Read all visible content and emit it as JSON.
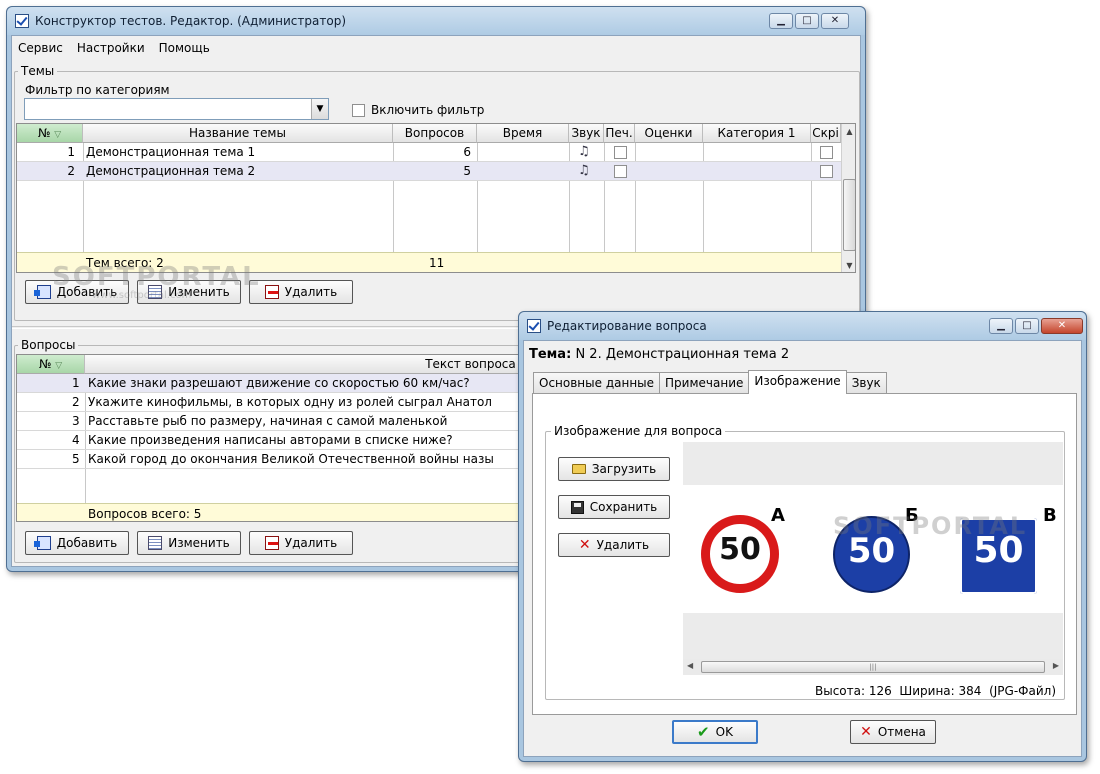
{
  "main_window": {
    "title": "Конструктор тестов. Редактор.  (Администратор)",
    "menu": [
      "Сервис",
      "Настройки",
      "Помощь"
    ],
    "topics": {
      "group_label": "Темы",
      "filter_label": "Фильтр по категориям",
      "filter_value": "",
      "enable_filter_label": "Включить фильтр",
      "columns": [
        "№",
        "Название темы",
        "Вопросов",
        "Время",
        "Звук",
        "Печ.",
        "Оценки",
        "Категория 1",
        "Скрі"
      ],
      "rows": [
        {
          "num": "1",
          "name": "Демонстрационная тема 1",
          "questions": "6"
        },
        {
          "num": "2",
          "name": "Демонстрационная тема 2",
          "questions": "5"
        }
      ],
      "footer_label": "Тем всего: 2",
      "footer_total": "11",
      "buttons": {
        "add": "Добавить",
        "edit": "Изменить",
        "delete": "Удалить"
      }
    },
    "questions": {
      "group_label": "Вопросы",
      "columns": [
        "№",
        "Текст вопроса"
      ],
      "rows": [
        {
          "num": "1",
          "text": "Какие знаки разрешают движение со скоростью 60 км/час?"
        },
        {
          "num": "2",
          "text": "Укажите кинофильмы, в которых одну из ролей сыграл Анатол"
        },
        {
          "num": "3",
          "text": "Расставьте рыб по размеру, начиная с самой маленькой"
        },
        {
          "num": "4",
          "text": "Какие произведения написаны авторами в списке ниже?"
        },
        {
          "num": "5",
          "text": "Какой город до окончания Великой Отечественной войны назы"
        }
      ],
      "footer_label": "Вопросов всего: 5",
      "buttons": {
        "add": "Добавить",
        "edit": "Изменить",
        "delete": "Удалить"
      }
    }
  },
  "dialog": {
    "title": "Редактирование вопроса",
    "topic_label": "Тема:",
    "topic_value": "N 2. Демонстрационная тема 2",
    "tabs": [
      "Основные данные",
      "Примечание",
      "Изображение",
      "Звук"
    ],
    "active_tab": "Изображение",
    "image_group_label": "Изображение для вопроса",
    "buttons": {
      "load": "Загрузить",
      "save": "Сохранить",
      "delete": "Удалить"
    },
    "signs": [
      {
        "letter": "А",
        "number": "50"
      },
      {
        "letter": "Б",
        "number": "50"
      },
      {
        "letter": "В",
        "number": "50"
      }
    ],
    "image_info": {
      "height_label": "Высота:",
      "height": "126",
      "width_label": "Ширина:",
      "width": "384",
      "type": "(JPG-Файл)"
    },
    "ok": "OK",
    "cancel": "Отмена"
  },
  "watermark": {
    "brand": "SOFTPORTAL",
    "url": "www.softportal.com"
  },
  "colors": {
    "footer_row": "#fffbd8",
    "selected_row": "#e7e7f4",
    "sign_red": "#d91a1a",
    "sign_blue": "#1c3fa6"
  }
}
